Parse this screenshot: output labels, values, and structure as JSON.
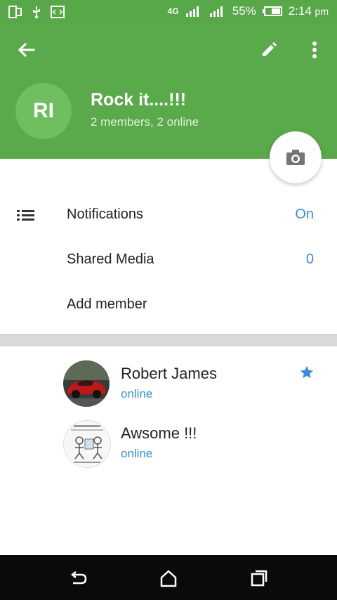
{
  "statusbar": {
    "network": "4G",
    "battery": "55%",
    "time": "2:14",
    "ampm": "pm"
  },
  "header": {
    "avatar_initials": "RI",
    "title": "Rock it....!!!",
    "subtitle": "2 members, 2 online",
    "color": "#5aa94b"
  },
  "settings": [
    {
      "label": "Notifications",
      "value": "On"
    },
    {
      "label": "Shared Media",
      "value": "0"
    },
    {
      "label": "Add member",
      "value": ""
    }
  ],
  "members": [
    {
      "name": "Robert James",
      "status": "online",
      "starred": true
    },
    {
      "name": "Awsome !!!",
      "status": "online",
      "starred": false
    }
  ],
  "icons": {
    "back": "arrow-left-icon",
    "edit": "pencil-icon",
    "more": "more-vert-icon",
    "camera": "camera-icon",
    "notifications": "list-icon",
    "star": "star-icon"
  }
}
